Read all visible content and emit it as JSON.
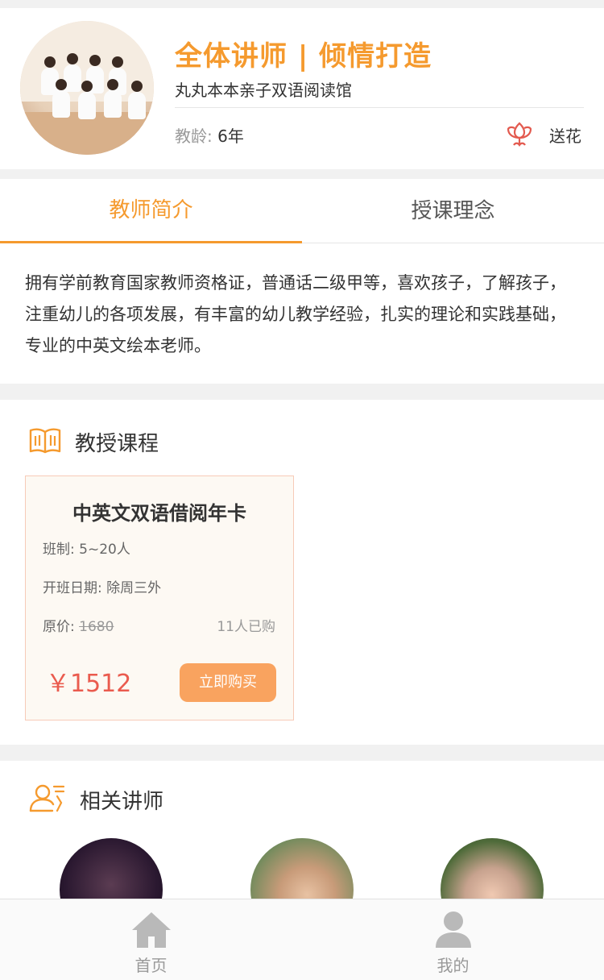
{
  "teacher": {
    "title": "全体讲师 | 倾情打造",
    "org": "丸丸本本亲子双语阅读馆",
    "age_label": "教龄:",
    "age_value": "6年",
    "flower_label": "送花"
  },
  "tabs": [
    {
      "label": "教师简介",
      "active": true
    },
    {
      "label": "授课理念",
      "active": false
    }
  ],
  "intro_text": "拥有学前教育国家教师资格证，普通话二级甲等，喜欢孩子，了解孩子，注重幼儿的各项发展，有丰富的幼儿教学经验，扎实的理论和实践基础，专业的中英文绘本老师。",
  "courses": {
    "section_title": "教授课程",
    "items": [
      {
        "name": "中英文双语借阅年卡",
        "class_size_label": "班制:",
        "class_size": "5~20人",
        "schedule_label": "开班日期:",
        "schedule": "除周三外",
        "orig_price_label": "原价:",
        "orig_price": "1680",
        "buyers": "11人已购",
        "price": "￥1512",
        "buy_label": "立即购买"
      }
    ]
  },
  "related": {
    "section_title": "相关讲师"
  },
  "bottom_nav": [
    {
      "label": "首页",
      "icon": "home-icon"
    },
    {
      "label": "我的",
      "icon": "user-icon"
    }
  ],
  "colors": {
    "accent": "#f59a2e",
    "price": "#ea5b4e",
    "button": "#f9a35f",
    "flower": "#e35a4f"
  }
}
